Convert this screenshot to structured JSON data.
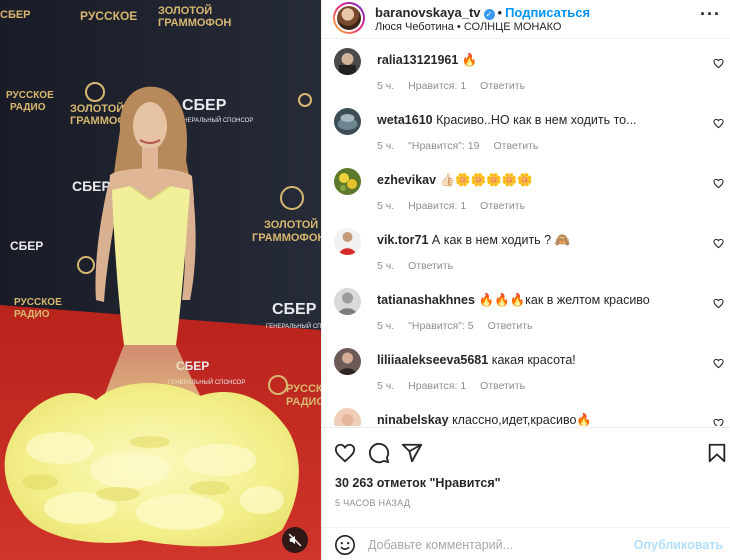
{
  "post": {
    "username": "baranovskaya_tv",
    "follow_label": "Подписаться",
    "dot": "•",
    "subtitle": "Люся Чеботина • СОЛНЦЕ МОНАКО",
    "more_icon": "more-horizontal-icon"
  },
  "media": {
    "backdrop_logos": [
      "ЗОЛОТОЙ ГРАММОФОН",
      "СБЕР",
      "ГЕНЕРАЛЬНЫЙ СПОНСОР",
      "РУССКОЕ РАДИО"
    ],
    "logo_top": "ЗОЛОТОЙ",
    "logo_bottom": "ГРАММОФОН",
    "sber": "СБЕР",
    "sponsor": "ГЕНЕРАЛЬНЫЙ СПОНСОР",
    "radio_top": "РУССКОЕ",
    "radio_bottom": "РАДИО",
    "mute_icon": "volume-muted-icon"
  },
  "comments": [
    {
      "user": "ralia13121961",
      "text": "🔥",
      "time": "5 ч.",
      "likes": "Нравится: 1",
      "reply": "Ответить"
    },
    {
      "user": "weta1610",
      "text": "Красиво..НО как в нем ходить то...",
      "time": "5 ч.",
      "likes": "\"Нравится\": 19",
      "reply": "Ответить"
    },
    {
      "user": "ezhevikav",
      "text": "👍🏻🌼🌼🌼🌼🌼",
      "time": "5 ч.",
      "likes": "Нравится: 1",
      "reply": "Ответить"
    },
    {
      "user": "vik.tor71",
      "text": "А как в нем ходить ? 🙈",
      "time": "5 ч.",
      "likes": "",
      "reply": "Ответить"
    },
    {
      "user": "tatianashakhnes",
      "text": "🔥🔥🔥как в желтом красиво",
      "time": "5 ч.",
      "likes": "\"Нравится\": 5",
      "reply": "Ответить"
    },
    {
      "user": "liliiaalekseeva5681",
      "text": "какая красота!",
      "time": "5 ч.",
      "likes": "Нравится: 1",
      "reply": "Ответить"
    },
    {
      "user": "ninabelskay",
      "text": "классно,идет,красиво🔥",
      "time": "",
      "likes": "",
      "reply": ""
    }
  ],
  "actions": {
    "icons": [
      "heart-icon",
      "comment-icon",
      "share-icon",
      "bookmark-icon"
    ],
    "likes_count": "30 263 отметок \"Нравится\"",
    "time_ago": "5 часов назад"
  },
  "composer": {
    "placeholder": "Добавьте комментарий...",
    "publish_label": "Опубликовать",
    "publish_color": "#b2dffc"
  },
  "colors": {
    "accent": "#0095f6",
    "carpet": "#c8281f",
    "backdrop": "#1e2330",
    "dress": "#f1ef9a"
  }
}
